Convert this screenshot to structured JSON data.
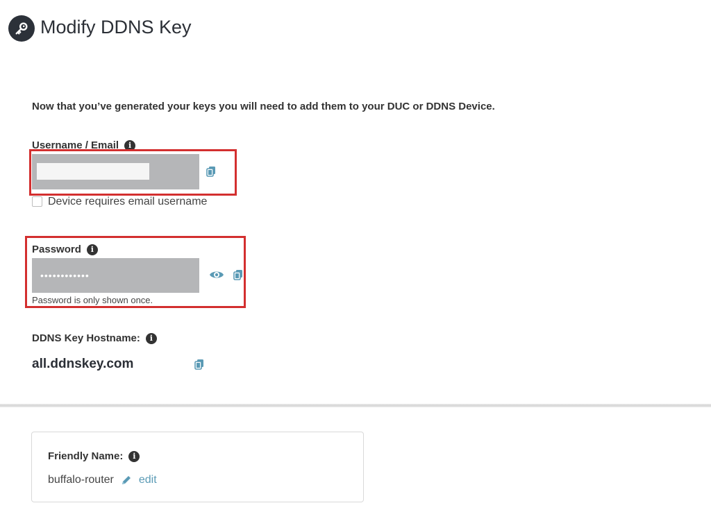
{
  "header": {
    "title": "Modify DDNS Key",
    "icon": "key-icon"
  },
  "intro_text": "Now that you’ve generated your keys you will need to add them to your DUC or DDNS Device.",
  "username": {
    "label": "Username / Email",
    "value": "",
    "checkbox_label": "Device requires email username",
    "checkbox_checked": false
  },
  "password": {
    "label": "Password",
    "masked_value": "••••••••••••",
    "hint": "Password is only shown once."
  },
  "hostname": {
    "label": "DDNS Key Hostname:",
    "value": "all.ddnskey.com"
  },
  "friendly_name": {
    "label": "Friendly Name:",
    "value": "buffalo-router",
    "edit_label": "edit"
  },
  "colors": {
    "accent": "#5a9ab5",
    "highlight": "#d32f2f",
    "field_bg": "#b5b6b8"
  }
}
